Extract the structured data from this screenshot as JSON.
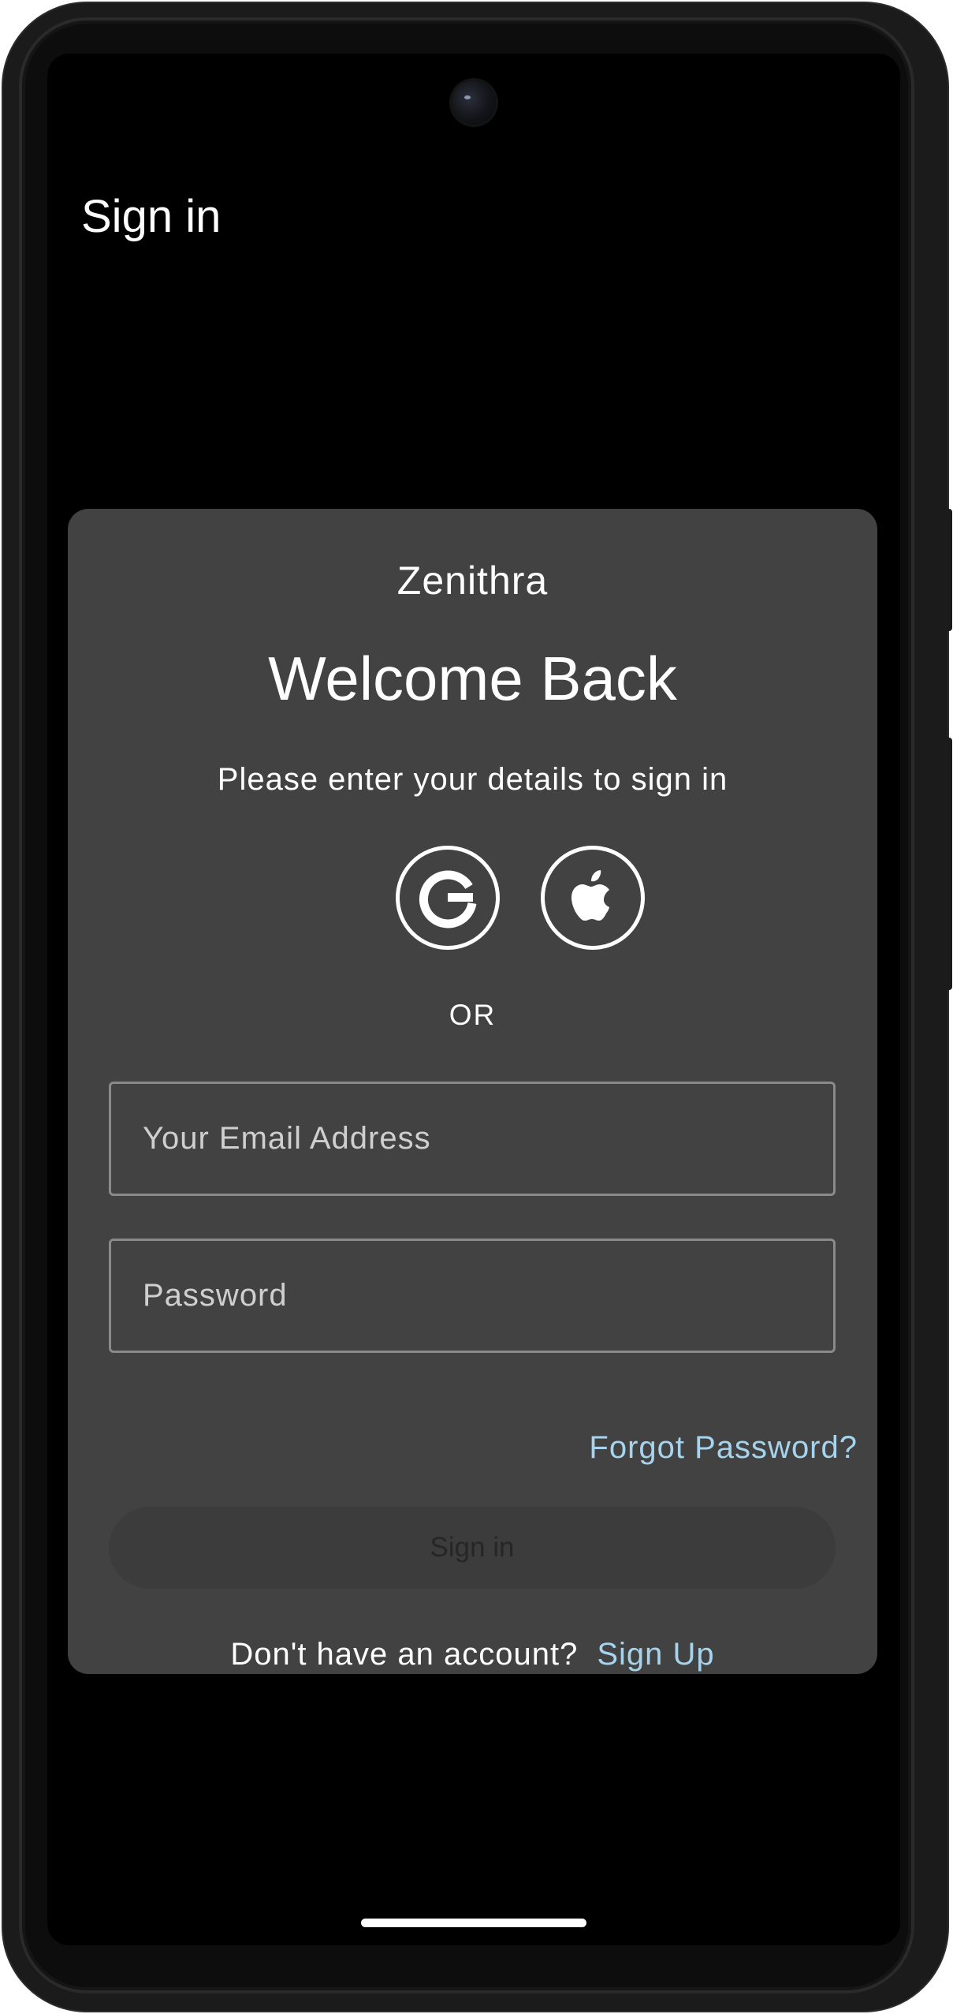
{
  "app_bar": {
    "title": "Sign in"
  },
  "card": {
    "brand": "Zenithra",
    "heading": "Welcome Back",
    "subtitle": "Please enter your details to sign in",
    "social": [
      {
        "provider": "google",
        "icon": "google-icon"
      },
      {
        "provider": "apple",
        "icon": "apple-icon"
      }
    ],
    "divider_text": "OR",
    "email": {
      "placeholder": "Your Email Address",
      "value": ""
    },
    "password": {
      "placeholder": "Password",
      "value": ""
    },
    "forgot_label": "Forgot Password?",
    "signin_label": "Sign in",
    "signup_prompt": "Don't have an account?",
    "signup_label": "Sign Up"
  },
  "colors": {
    "background": "#000000",
    "card": "#424242",
    "link": "#a6d4ee",
    "text": "#ffffff",
    "disabled_button": "#3c3c3c"
  }
}
